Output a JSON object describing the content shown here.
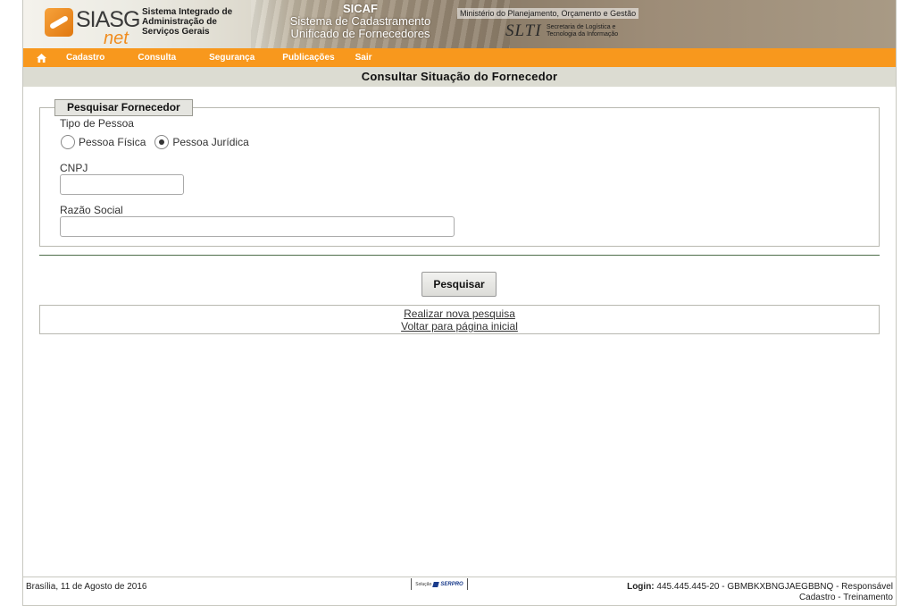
{
  "header": {
    "logo_text": "SIASG",
    "logo_sub": "net",
    "system_name_lines": [
      "Sistema Integrado de",
      "Administração de",
      "Serviços Gerais"
    ],
    "sicaf_title": "SICAF",
    "sicaf_sub_lines": [
      "Sistema de Cadastramento",
      "Unificado de Fornecedores"
    ],
    "ministerio": "Ministério do Planejamento, Orçamento e Gestão",
    "slti_mark": "SLTI",
    "slti_lines": [
      "Secretaria de Logística e",
      "Tecnologia da Informação"
    ]
  },
  "menu": {
    "home_icon": "home-icon",
    "items": [
      {
        "label": "Cadastro"
      },
      {
        "label": "Consulta"
      },
      {
        "label": "Segurança"
      },
      {
        "label": "Publicações"
      },
      {
        "label": "Sair"
      }
    ]
  },
  "page": {
    "title": "Consultar Situação do Fornecedor"
  },
  "form": {
    "legend": "Pesquisar Fornecedor",
    "tipo_pessoa_label": "Tipo de Pessoa",
    "radio_fisica": "Pessoa Física",
    "radio_juridica": "Pessoa Jurídica",
    "selected": "Pessoa Jurídica",
    "cnpj_label": "CNPJ",
    "cnpj_value": "",
    "razao_label": "Razão Social",
    "razao_value": "",
    "submit_label": "Pesquisar"
  },
  "links": {
    "nova_pesquisa": "Realizar nova pesquisa",
    "voltar": "Voltar para página inicial"
  },
  "footer": {
    "date": "Brasília, 11 de Agosto de 2016",
    "serpro_prefix": "Solução",
    "serpro_name": "SERPRO",
    "login_label": "Login:",
    "login_value": "445.445.445-20 - GBMBKXBNGJAEGBBNQ - Responsável",
    "login_line2": "Cadastro - Treinamento"
  },
  "colors": {
    "menu_bg": "#f8981d",
    "title_bg": "#dcdcd2",
    "divider": "#4e6e4a"
  }
}
